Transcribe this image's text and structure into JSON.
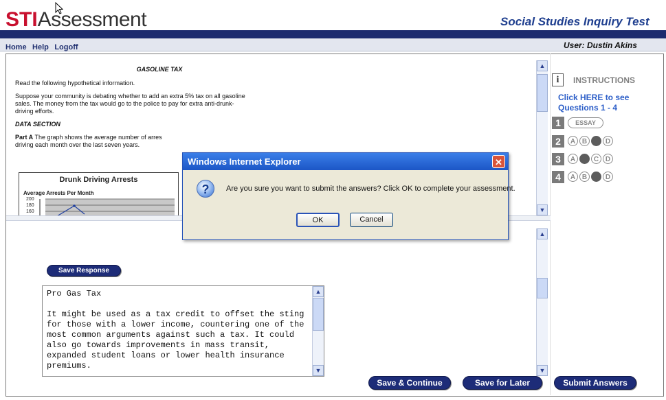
{
  "header": {
    "logo_sti": "STI",
    "logo_assessment": "Assessment",
    "test_title": "Social Studies Inquiry Test",
    "nav": [
      "Home",
      "Help",
      "Logoff"
    ],
    "user": "User: Dustin Akins"
  },
  "passage": {
    "title": "GASOLINE TAX",
    "p1": "Read the following hypothetical information.",
    "p2": "Suppose your community is debating whether to add an extra 5% tax on all gasoline sales. The money from the tax would go to the police to pay for extra anti-drunk-driving efforts.",
    "data_section": "DATA SECTION",
    "partA_label": "Part A",
    "partA_text": " The graph shows the average number of arres",
    "partA_text2": "driving each month over the last seven years.",
    "chart_title": "Drunk Driving Arrests",
    "chart_ylabel": "Average Arrests Per Month",
    "chart_ticks": [
      "200",
      "180",
      "160"
    ]
  },
  "instructions": {
    "label": "INSTRUCTIONS",
    "link": "Click HERE to see Questions 1 - 4",
    "questions": [
      {
        "num": "1",
        "type": "essay",
        "label": "ESSAY"
      },
      {
        "num": "2",
        "options": [
          "A",
          "B",
          "C",
          "D"
        ],
        "selected": "C"
      },
      {
        "num": "3",
        "options": [
          "A",
          "B",
          "C",
          "D"
        ],
        "selected": "B"
      },
      {
        "num": "4",
        "options": [
          "A",
          "B",
          "C",
          "D"
        ],
        "selected": "C"
      }
    ]
  },
  "response": {
    "save_label": "Save Response",
    "essay": "Pro Gas Tax\n\nIt might be used as a tax credit to offset the sting for those with a lower income, countering one of the most common arguments against such a tax. It could also go towards improvements in mass transit, expanded student loans or lower health insurance premiums."
  },
  "buttons": {
    "save_continue": "Save & Continue",
    "save_later": "Save for Later",
    "submit": "Submit Answers"
  },
  "dialog": {
    "title": "Windows Internet Explorer",
    "message": "Are you sure you want to submit the answers? Click OK to complete your assessment.",
    "ok": "OK",
    "cancel": "Cancel"
  }
}
